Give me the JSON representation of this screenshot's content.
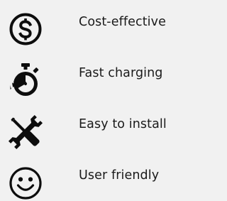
{
  "colors": {
    "background": "#f1f1f1",
    "icon": "#0d0d0d",
    "text": "#1a1a1a"
  },
  "features": [
    {
      "label": "Cost-effective",
      "icon": "dollar-circle-icon"
    },
    {
      "label": "Fast charging",
      "icon": "stopwatch-icon"
    },
    {
      "label": "Easy to install",
      "icon": "wrench-screwdriver-icon"
    },
    {
      "label": "User friendly",
      "icon": "smiley-face-icon"
    }
  ]
}
